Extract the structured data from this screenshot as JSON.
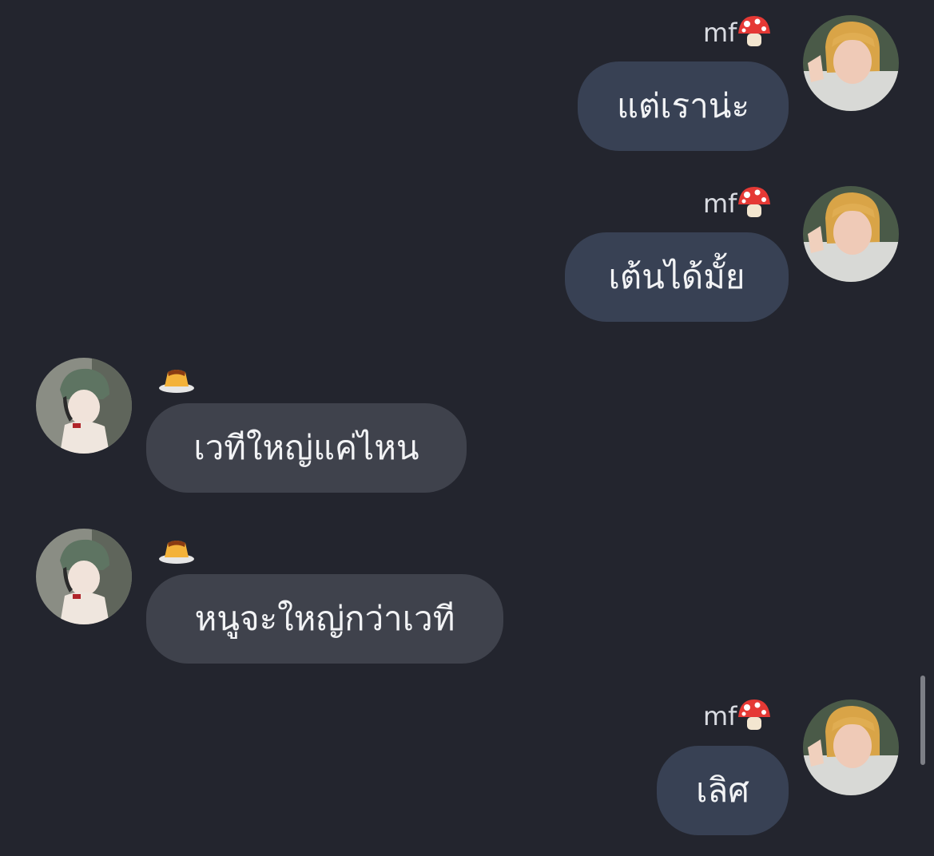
{
  "messages": [
    {
      "side": "right",
      "name": "mf",
      "name_icon": "mushroom-icon",
      "text": "แต่เราน่ะ"
    },
    {
      "side": "right",
      "name": "mf",
      "name_icon": "mushroom-icon",
      "text": "เต้นได้มั้ย"
    },
    {
      "side": "left",
      "name": "",
      "name_icon": "pudding-icon",
      "text": "เวทีใหญ่แค่ไหน"
    },
    {
      "side": "left",
      "name": "",
      "name_icon": "pudding-icon",
      "text": "หนูจะใหญ่กว่าเวที"
    },
    {
      "side": "right",
      "name": "mf",
      "name_icon": "mushroom-icon",
      "text": "เลิศ"
    }
  ],
  "colors": {
    "background": "#23252e",
    "bubble_right": "#384154",
    "bubble_left": "#3f424c",
    "text": "#f2f3f5",
    "name": "#d9dbe1"
  }
}
